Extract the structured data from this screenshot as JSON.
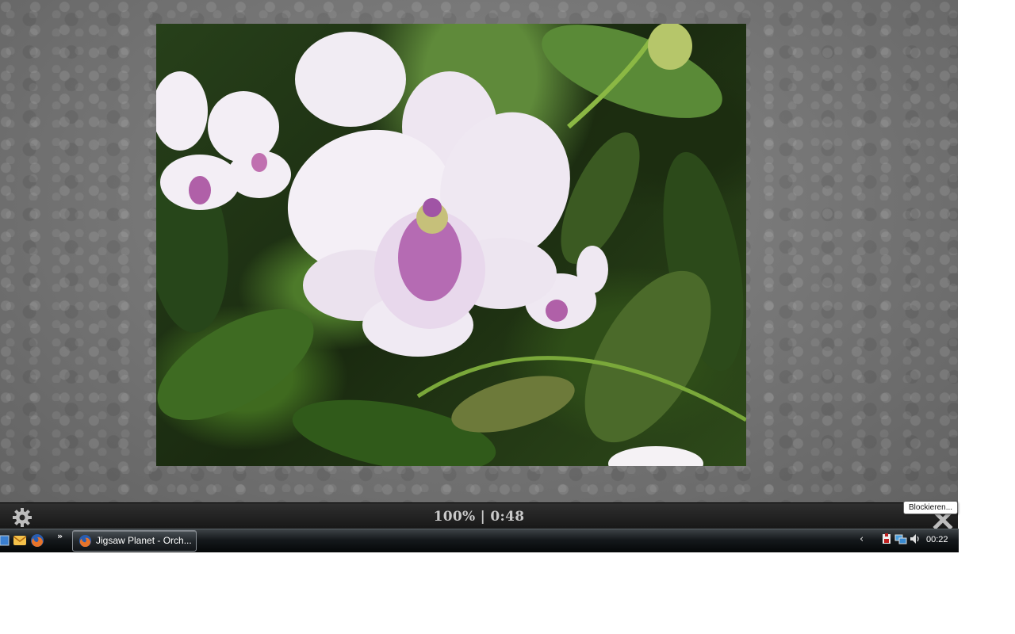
{
  "puzzle": {
    "image_subject": "white-pink orchid",
    "progress_text": "100% | 0:48"
  },
  "tooltip": {
    "text": "Blockieren..."
  },
  "icons": {
    "settings": "gear-icon",
    "close": "close-icon",
    "show_desktop": "show-desktop-icon",
    "quicklaunch_mail": "thunderbird-icon",
    "quicklaunch_browser": "firefox-icon",
    "tray_expand": "chevron-left-icon",
    "tray_1": "security-icon",
    "tray_2": "network-icon",
    "tray_3": "volume-icon"
  },
  "taskbar": {
    "quicklaunch_more": "»",
    "active_task_label": "Jigsaw Planet - Orch...",
    "tray_chevron": "‹",
    "clock": "00:22"
  },
  "colors": {
    "game_bg": "#767676",
    "status_bar": "#1f1f1f",
    "progress_text": "#c9c9c9",
    "taskbar": "#15191c"
  }
}
